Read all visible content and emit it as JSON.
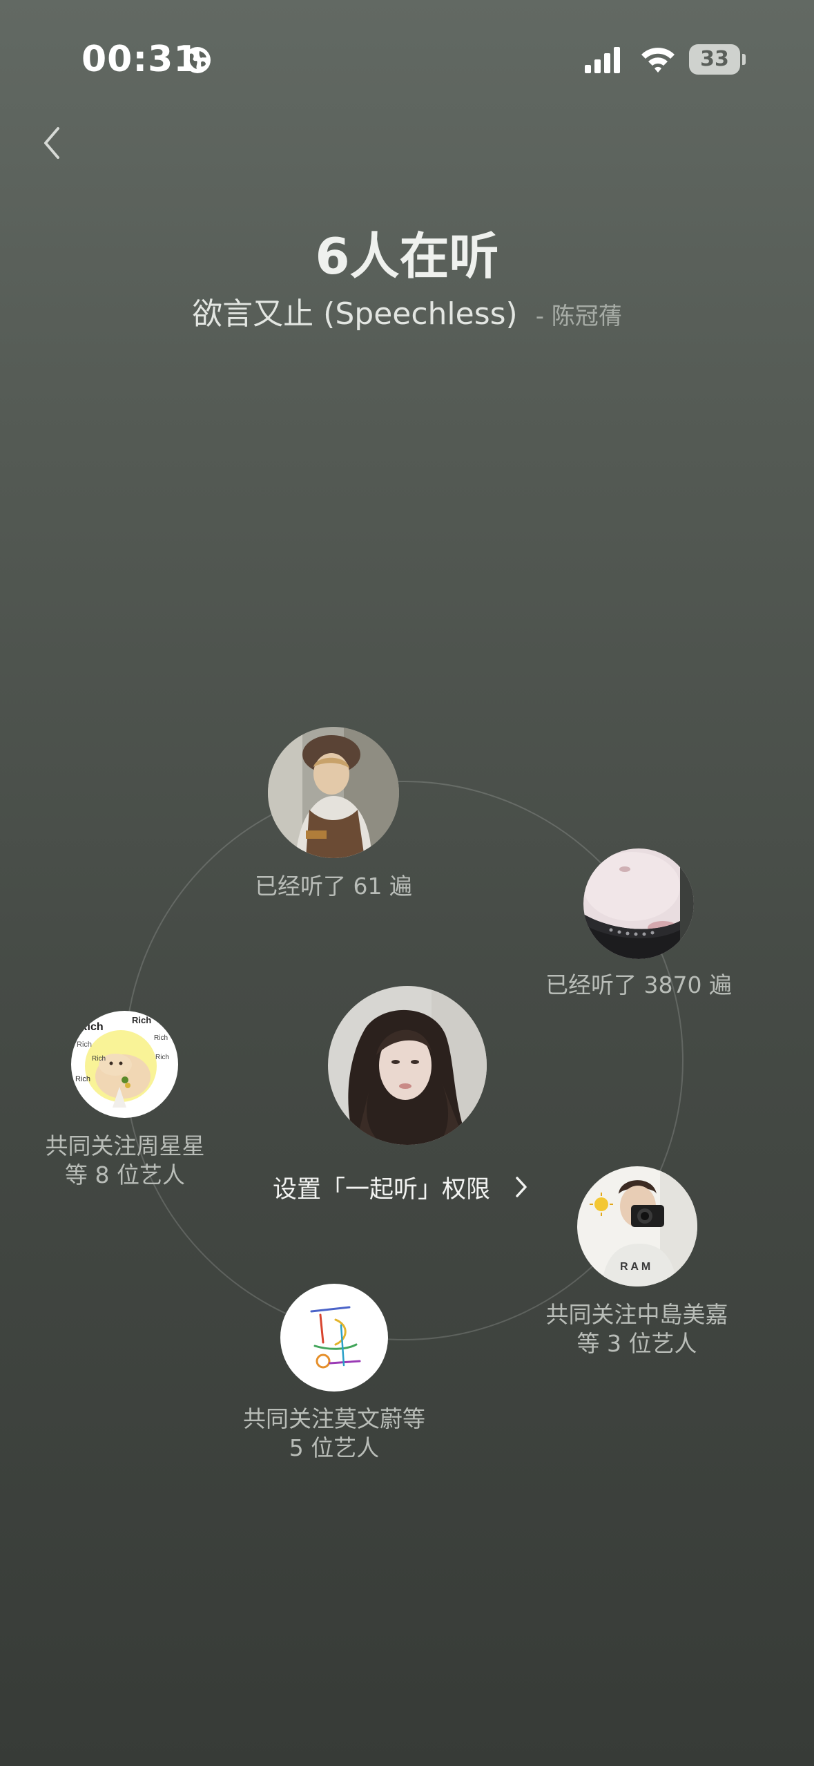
{
  "status_bar": {
    "time": "00:31",
    "battery": "33"
  },
  "header": {
    "title": "6人在听",
    "song": "欲言又止 (Speechless)",
    "artist": "- 陈冠蒨"
  },
  "center": {
    "permission_link": "设置「一起听」权限"
  },
  "listeners": [
    {
      "label": "已经听了 61 遍"
    },
    {
      "label": "已经听了 3870 遍"
    },
    {
      "label": "共同关注周星星等 8 位艺人"
    },
    {
      "label": "共同关注中島美嘉等 3 位艺人"
    },
    {
      "label": "共同关注莫文蔚等 5 位艺人"
    }
  ],
  "avatar_texts": [
    "Rich"
  ],
  "icons": {
    "back": "chevron-left-icon",
    "globe": "globe-icon",
    "signal": "cellular-signal-icon",
    "wifi": "wifi-icon",
    "battery": "battery-icon",
    "permission_chevron": "chevron-right-icon"
  }
}
